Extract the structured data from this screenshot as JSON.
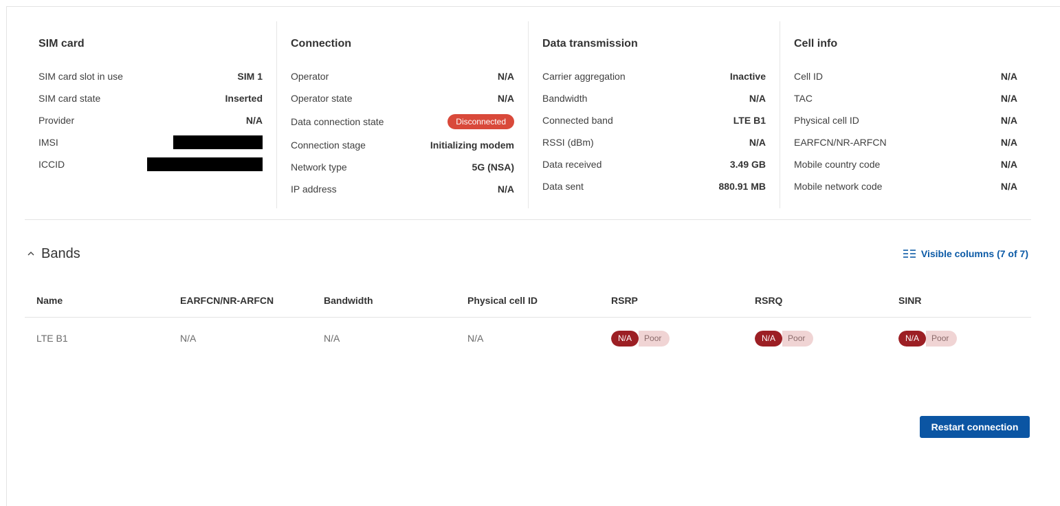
{
  "sections": [
    {
      "title": "SIM card",
      "rows": [
        {
          "label": "SIM card slot in use",
          "value": "SIM 1"
        },
        {
          "label": "SIM card state",
          "value": "Inserted"
        },
        {
          "label": "Provider",
          "value": "N/A"
        },
        {
          "label": "IMSI",
          "value": ""
        },
        {
          "label": "ICCID",
          "value": ""
        }
      ]
    },
    {
      "title": "Connection",
      "rows": [
        {
          "label": "Operator",
          "value": "N/A"
        },
        {
          "label": "Operator state",
          "value": "N/A"
        },
        {
          "label": "Data connection state",
          "value": "Disconnected"
        },
        {
          "label": "Connection stage",
          "value": "Initializing modem"
        },
        {
          "label": "Network type",
          "value": "5G (NSA)"
        },
        {
          "label": "IP address",
          "value": "N/A"
        }
      ]
    },
    {
      "title": "Data transmission",
      "rows": [
        {
          "label": "Carrier aggregation",
          "value": "Inactive"
        },
        {
          "label": "Bandwidth",
          "value": "N/A"
        },
        {
          "label": "Connected band",
          "value": "LTE B1"
        },
        {
          "label": "RSSI (dBm)",
          "value": "N/A"
        },
        {
          "label": "Data received",
          "value": "3.49 GB"
        },
        {
          "label": "Data sent",
          "value": "880.91 MB"
        }
      ]
    },
    {
      "title": "Cell info",
      "rows": [
        {
          "label": "Cell ID",
          "value": "N/A"
        },
        {
          "label": "TAC",
          "value": "N/A"
        },
        {
          "label": "Physical cell ID",
          "value": "N/A"
        },
        {
          "label": "EARFCN/NR-ARFCN",
          "value": "N/A"
        },
        {
          "label": "Mobile country code",
          "value": "N/A"
        },
        {
          "label": "Mobile network code",
          "value": "N/A"
        }
      ]
    }
  ],
  "bands": {
    "title": "Bands",
    "visible_columns_label": "Visible columns (7 of 7)",
    "columns": [
      "Name",
      "EARFCN/NR-ARFCN",
      "Bandwidth",
      "Physical cell ID",
      "RSRP",
      "RSRQ",
      "SINR"
    ],
    "rows": [
      {
        "name": "LTE B1",
        "earfcn": "N/A",
        "bandwidth": "N/A",
        "pci": "N/A",
        "rsrp": {
          "value": "N/A",
          "quality": "Poor"
        },
        "rsrq": {
          "value": "N/A",
          "quality": "Poor"
        },
        "sinr": {
          "value": "N/A",
          "quality": "Poor"
        }
      }
    ]
  },
  "actions": {
    "restart_label": "Restart connection"
  },
  "colors": {
    "accent": "#0b55a3",
    "disconnected_badge": "#d9493a",
    "signal_poor_dark": "#9c1f24",
    "signal_poor_light": "#f0d4d4"
  },
  "icons": {
    "collapse": "chevron-up-icon",
    "columns": "list-columns-icon"
  }
}
